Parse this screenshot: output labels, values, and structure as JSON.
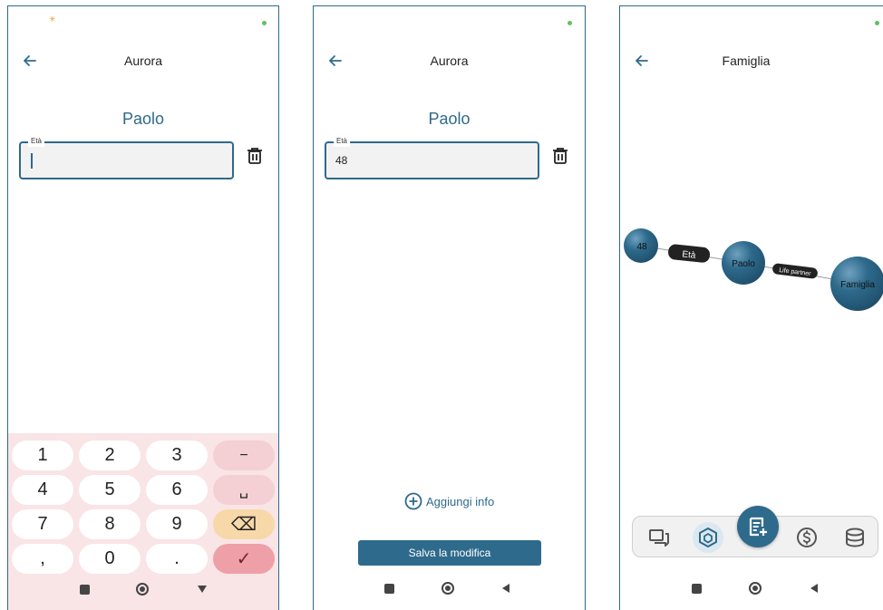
{
  "screens": [
    {
      "title": "Aurora",
      "person_name": "Paolo",
      "field": {
        "label": "Età",
        "value": ""
      },
      "keyboard": {
        "keys": [
          "1",
          "2",
          "3",
          "−",
          "4",
          "5",
          "6",
          "␣",
          "7",
          "8",
          "9",
          "⌫",
          ",",
          "0",
          ".",
          "✓"
        ]
      }
    },
    {
      "title": "Aurora",
      "person_name": "Paolo",
      "field": {
        "label": "Età",
        "value": "48"
      },
      "add_info_label": "Aggiungi info",
      "save_label": "Salva la modifica"
    },
    {
      "title": "Famiglia",
      "graph": {
        "nodes": [
          "48",
          "Paolo",
          "Famiglia"
        ],
        "edges": [
          "Età",
          "Life partner"
        ]
      },
      "toolbar": [
        "chat-icon",
        "cube-icon",
        "add-note-icon",
        "dollar-icon",
        "database-icon"
      ]
    }
  ],
  "colors": {
    "accent": "#2e6a8c",
    "keyboard_bg": "#f9e4e6",
    "confirm_key": "#ee9fa8",
    "backspace_key": "#f7d8a8"
  }
}
